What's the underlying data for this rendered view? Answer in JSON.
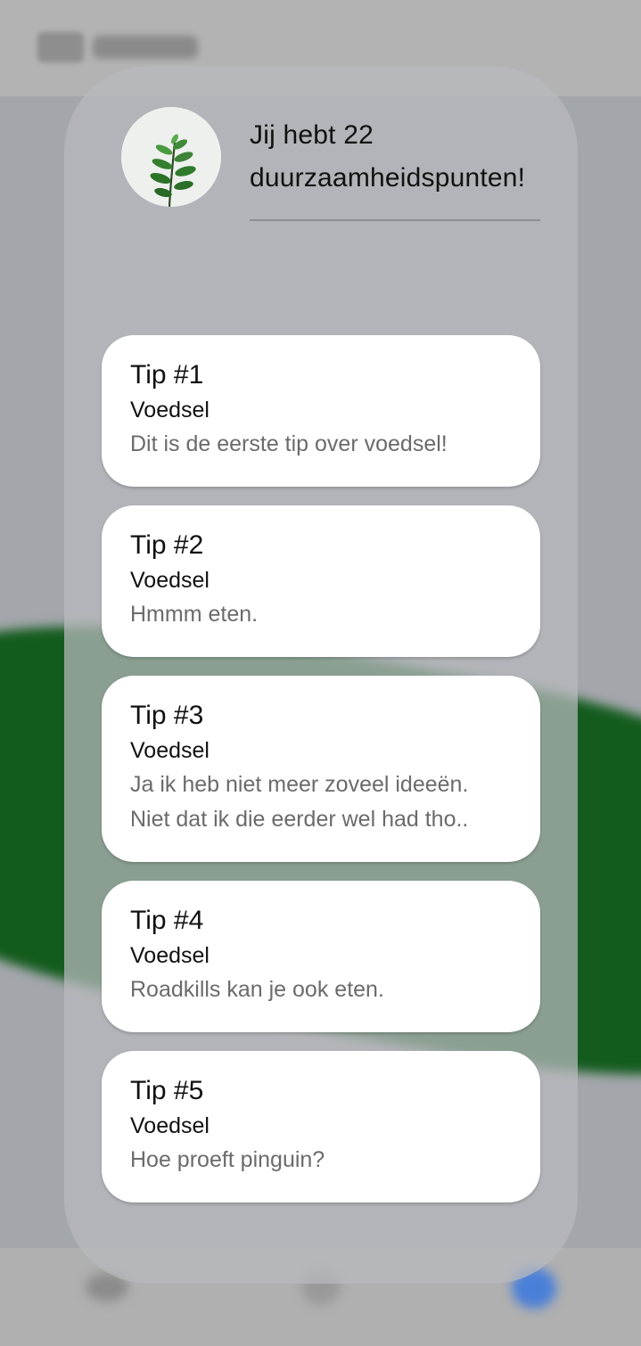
{
  "points": {
    "text": "Jij hebt 22 duurzaamheidspunten!"
  },
  "avatar": {
    "icon": "plant-icon"
  },
  "tips": [
    {
      "title": "Tip #1",
      "category": "Voedsel",
      "body": [
        "Dit is de eerste tip over voedsel!"
      ]
    },
    {
      "title": "Tip #2",
      "category": "Voedsel",
      "body": [
        "Hmmm eten."
      ]
    },
    {
      "title": "Tip #3",
      "category": "Voedsel",
      "body": [
        "Ja ik heb niet meer zoveel ideeën.",
        "Niet dat ik die eerder wel had tho.."
      ]
    },
    {
      "title": "Tip #4",
      "category": "Voedsel",
      "body": [
        "Roadkills kan je ook eten."
      ]
    },
    {
      "title": "Tip #5",
      "category": "Voedsel",
      "body": [
        "Hoe proeft pinguin?"
      ]
    }
  ],
  "colors": {
    "accent_green": "#145c1e",
    "card_background": "#ffffff",
    "muted_text": "#6b6b6b"
  }
}
